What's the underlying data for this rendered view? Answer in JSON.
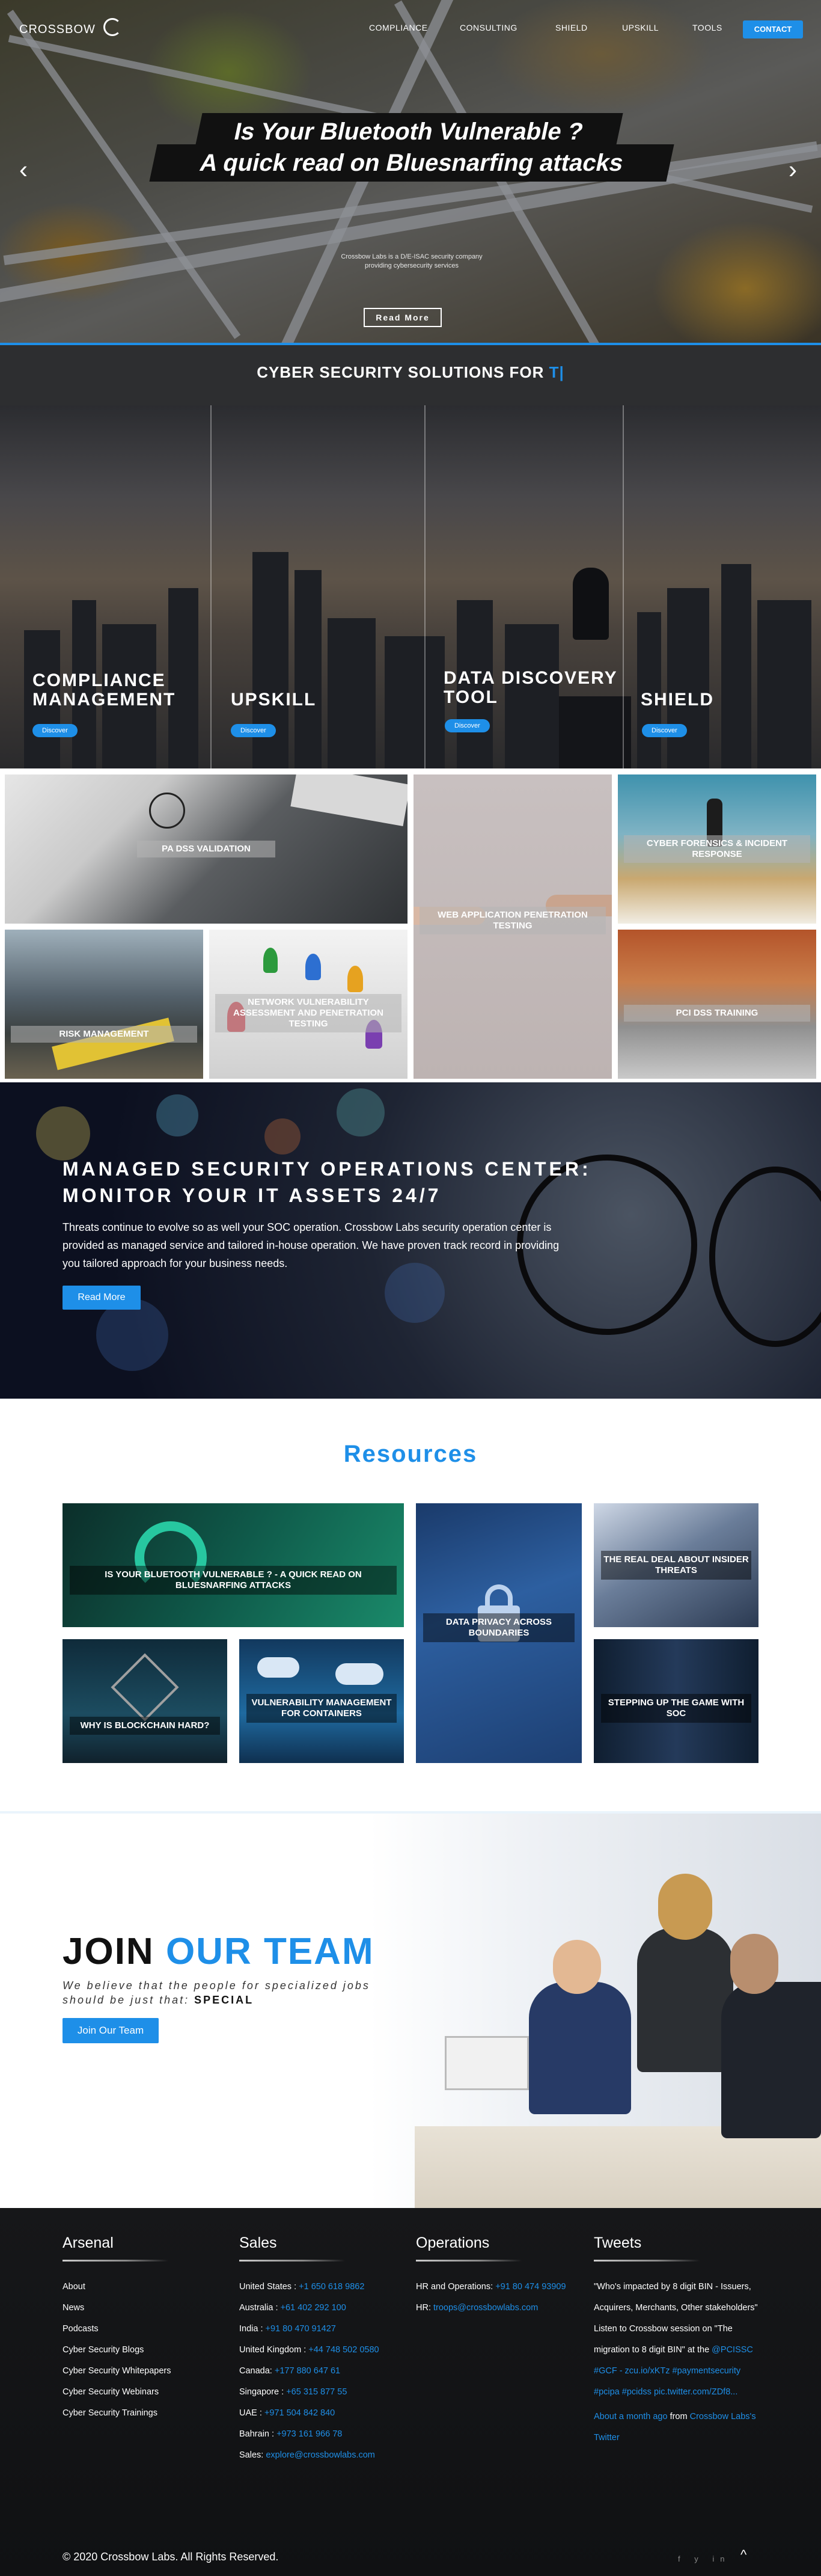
{
  "header": {
    "logo": "CROSSBOW",
    "nav": [
      "COMPLIANCE",
      "CONSULTING",
      "SHIELD",
      "UPSKILL",
      "TOOLS"
    ],
    "contact": "CONTACT"
  },
  "hero": {
    "line1": "Is Your Bluetooth Vulnerable ?",
    "line2": "A quick read on Bluesnarfing attacks",
    "small": "Crossbow Labs is a D/E-ISAC security company providing cybersecurity services",
    "read_more": "Read More",
    "prev": "‹",
    "next": "›"
  },
  "solutions": {
    "title": "CYBER SECURITY SOLUTIONS FOR ",
    "highlight": "T|",
    "panels": [
      {
        "title": "COMPLIANCE MANAGEMENT",
        "button": "Discover"
      },
      {
        "title": "UPSKILL",
        "button": "Discover"
      },
      {
        "title": "DATA DISCOVERY TOOL",
        "button": "Discover"
      },
      {
        "title": "SHIELD",
        "button": "Discover"
      }
    ]
  },
  "services": [
    "PA DSS VALIDATION",
    "WEB APPLICATION PENETRATION TESTING",
    "CYBER FORENSICS & INCIDENT RESPONSE",
    "RISK MANAGEMENT",
    "NETWORK VULNERABILITY ASSESSMENT AND PENETRATION TESTING",
    "PCI DSS TRAINING"
  ],
  "soc": {
    "heading": "MANAGED SECURITY OPERATIONS CENTER: MONITOR YOUR IT ASSETS 24/7",
    "text": "Threats continue to evolve so as well your SOC operation. Crossbow Labs security operation center is provided as managed service and tailored in-house operation. We have proven track record in providing you tailored approach for your business needs.",
    "button": "Read More"
  },
  "resources": {
    "title": "Resources",
    "items": [
      "IS YOUR BLUETOOTH VULNERABLE ? - A QUICK READ ON BLUESNARFING ATTACKS",
      "DATA PRIVACY ACROSS BOUNDARIES",
      "THE REAL DEAL ABOUT INSIDER THREATS",
      "WHY IS BLOCKCHAIN HARD?",
      "VULNERABILITY MANAGEMENT FOR CONTAINERS",
      "STEPPING UP THE GAME WITH SOC"
    ]
  },
  "team": {
    "join": "JOIN ",
    "our_team": "OUR TEAM",
    "text": "We believe that the people for specialized jobs should be just that: ",
    "special": "SPECIAL",
    "button": "Join Our Team"
  },
  "footer": {
    "arsenal": {
      "title": "Arsenal",
      "links": [
        "About",
        "News",
        "Podcasts",
        "Cyber Security Blogs",
        "Cyber Security Whitepapers",
        "Cyber Security Webinars",
        "Cyber Security Trainings"
      ]
    },
    "sales": {
      "title": "Sales",
      "rows": [
        {
          "label": "United States : ",
          "value": "+1 650 618 9862"
        },
        {
          "label": "Australia : ",
          "value": "+61 402 292 100"
        },
        {
          "label": "India : ",
          "value": "+91 80 470 91427"
        },
        {
          "label": "United Kingdom : ",
          "value": "+44 748 502 0580"
        },
        {
          "label": "Canada: ",
          "value": "+177 880 647 61"
        },
        {
          "label": "Singapore : ",
          "value": "+65 315 877 55"
        },
        {
          "label": "UAE : ",
          "value": "+971 504 842 840"
        },
        {
          "label": "Bahrain : ",
          "value": "+973 161 966 78"
        },
        {
          "label": "Sales: ",
          "value": "explore@crossbowlabs.com"
        }
      ]
    },
    "operations": {
      "title": "Operations",
      "rows": [
        {
          "label": "HR and Operations: ",
          "value": "+91 80 474 93909"
        },
        {
          "label": "HR: ",
          "value": "troops@crossbowlabs.com"
        }
      ]
    },
    "tweets": {
      "title": "Tweets",
      "text": "\"Who's impacted by 8 digit BIN - Issuers, Acquirers, Merchants, Other stakeholders\" Listen to Crossbow session on \"The migration to 8 digit BIN\" at the ",
      "links": "@PCISSC #GCF - zcu.io/xKTz #paymentsecurity #pcipa #pcidss pic.twitter.com/ZDf8...",
      "time": "About a month ago",
      "from": " from ",
      "source": "Crossbow Labs's Twitter"
    },
    "copyright": "© 2020 Crossbow Labs. All Rights Reserved.",
    "social": "f y in",
    "to_top": "^"
  }
}
